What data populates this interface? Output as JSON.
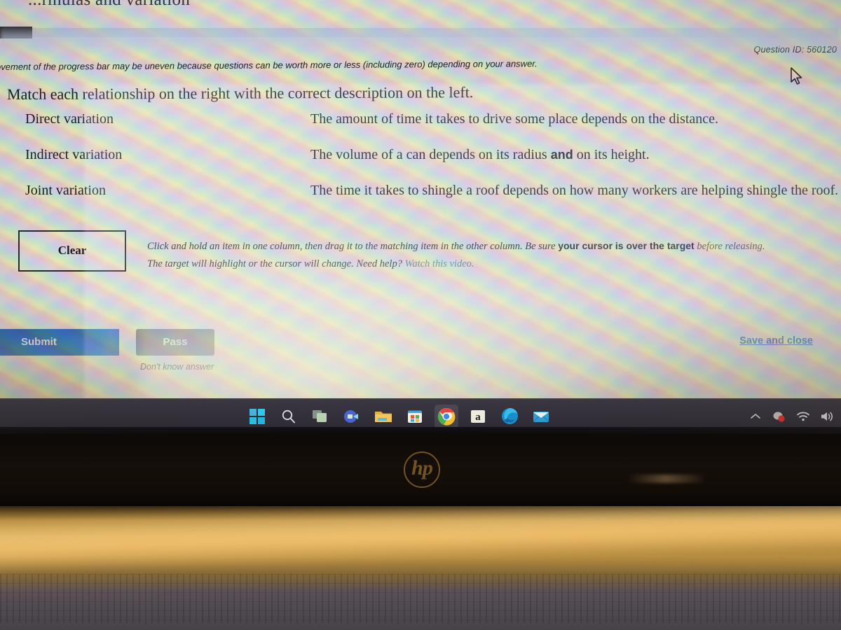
{
  "screen": {
    "clipped_title": "...rmulas and variation",
    "question_id": "Question ID: 560120",
    "progress_note": "ovement of the progress bar may be uneven because questions can be worth more or less (including zero) depending on your answer.",
    "prompt": "Match each relationship on the right with the correct description on the left.",
    "match": {
      "left_column": [
        {
          "label": "Direct variation"
        },
        {
          "label": "Indirect variation"
        },
        {
          "label": "Joint variation"
        }
      ],
      "right_column": [
        {
          "pre": "The amount of time it takes to drive some place depends on the distance.",
          "bold": "",
          "post": ""
        },
        {
          "pre": "The volume of a can depends on its radius ",
          "bold": "and",
          "post": " on its height."
        },
        {
          "pre": "The time it takes to shingle a roof depends on how many workers are helping shingle the roof.",
          "bold": "",
          "post": ""
        }
      ]
    },
    "clear_button": "Clear",
    "howto": {
      "line1_a": "Click and hold an item in one column, then drag it to the matching item in the other column. Be sure ",
      "line1_bold": "your cursor is over the target",
      "line1_b": " before releasing.",
      "line2_a": "The target will highlight or the cursor will change. Need help? ",
      "line2_link": "Watch this video."
    },
    "submit_button": "Submit",
    "pass_button": "Pass",
    "pass_caption": "Don't know answer",
    "save_and_close": "Save and close",
    "colors": {
      "submit_blue": "#1f6fc8",
      "pass_gray": "#7b7e90",
      "link_blue": "#3f6fb5",
      "video_link": "#4f8a95",
      "progress_fill": "#1d1b1c"
    }
  },
  "taskbar": {
    "items": [
      {
        "name": "start-icon",
        "label": "Start"
      },
      {
        "name": "search-icon",
        "label": "Search"
      },
      {
        "name": "task-view-icon",
        "label": "Task View"
      },
      {
        "name": "chat-icon",
        "label": "Chat"
      },
      {
        "name": "file-explorer-icon",
        "label": "File Explorer"
      },
      {
        "name": "microsoft-store-icon",
        "label": "Microsoft Store"
      },
      {
        "name": "google-chrome-icon",
        "label": "Google Chrome",
        "active": true
      },
      {
        "name": "amazon-icon",
        "label": "Amazon"
      },
      {
        "name": "microsoft-edge-icon",
        "label": "Microsoft Edge"
      },
      {
        "name": "mail-icon",
        "label": "Mail"
      }
    ],
    "tray": [
      {
        "name": "show-hidden-icons-chevron-icon",
        "label": "Show hidden icons"
      },
      {
        "name": "notification-alert-icon",
        "label": "Alert"
      },
      {
        "name": "wifi-icon",
        "label": "Network"
      },
      {
        "name": "volume-icon",
        "label": "Volume"
      }
    ]
  },
  "hardware": {
    "brand_logo": "hp"
  }
}
